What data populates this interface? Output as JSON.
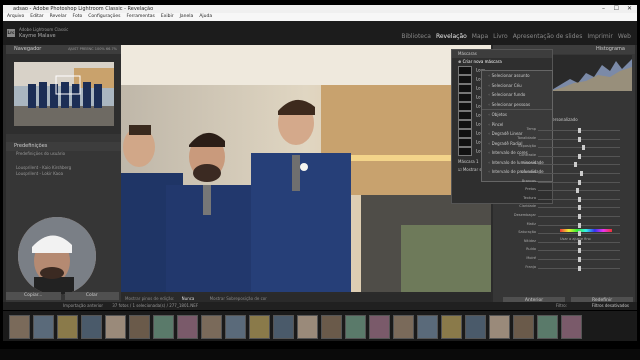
{
  "window": {
    "title": "adsao - Adobe Photoshop Lightroom Classic - Revelação",
    "controls": [
      "–",
      "☐",
      "✕"
    ]
  },
  "menubar": [
    "Arquivo",
    "Editar",
    "Revelar",
    "Foto",
    "Configurações",
    "Ferramentas",
    "Exibir",
    "Janela",
    "Ajuda"
  ],
  "identity": {
    "logo": "Lrc",
    "product": "Adobe Lightroom Classic",
    "user": "Kayme Malave"
  },
  "modules": [
    "Biblioteca",
    "Revelação",
    "Mapa",
    "Livro",
    "Apresentação de slides",
    "Imprimir",
    "Web"
  ],
  "active_module": "Revelação",
  "left_panel": {
    "navigator": {
      "title": "Navegador",
      "zoom_fit": "AJUST",
      "zoom_fill": "PREENC",
      "zoom_100": "100%",
      "zoom_custom": "66.7%"
    },
    "presets_title": "Predefinições",
    "preset_groups": [
      "Predefinições do usuário",
      "Lousprilent - Kaio Kirshberg",
      "Lousprilent - Lokir Kaoa"
    ],
    "copy_label": "Copiar...",
    "paste_label": "Colar"
  },
  "mask_panel": {
    "header": "Máscaras",
    "create_new": "Criar nova máscara",
    "items": [
      "Selecionar assunto",
      "Selecionar Céu",
      "Selecionar fundo",
      "Selecionar pessoas",
      "Objetos",
      "Pincel",
      "Degradê Linear",
      "Degradê Radial",
      "Intervalo de cores",
      "Intervalo de luminosidade",
      "Intervalo de profundidade"
    ],
    "mask_rows": [
      "Lous",
      "Lous",
      "Lous",
      "Lous",
      "Lous",
      "Lous",
      "Lous",
      "Lous",
      "Lous",
      "Lous"
    ],
    "footer_count": "Máscara 1",
    "overlay_label": "Mostrar sobreposição"
  },
  "right_panel": {
    "histogram": "Histograma",
    "mask_intensity_header": "Personalizado",
    "sliders": [
      {
        "label": "Temp",
        "value": 0.5
      },
      {
        "label": "Tonalidade",
        "value": 0.5
      },
      {
        "label": "Exposição",
        "value": 0.55
      },
      {
        "label": "Contraste",
        "value": 0.5
      },
      {
        "label": "Realces",
        "value": 0.45
      },
      {
        "label": "Sombras",
        "value": 0.52
      },
      {
        "label": "Brancos",
        "value": 0.5
      },
      {
        "label": "Pretos",
        "value": 0.48
      },
      {
        "label": "Textura",
        "value": 0.5
      },
      {
        "label": "Claridade",
        "value": 0.5
      },
      {
        "label": "Desembaçar",
        "value": 0.5
      },
      {
        "label": "Matiz",
        "value": 0.5
      },
      {
        "label": "Saturação",
        "value": 0.5
      },
      {
        "label": "Nitidez",
        "value": 0.5
      },
      {
        "label": "Ruído",
        "value": 0.5
      },
      {
        "label": "Moiré",
        "value": 0.5
      },
      {
        "label": "Franja",
        "value": 0.5
      }
    ],
    "hue_label": "Usar o ajuste fino",
    "prev_label": "Anterior",
    "reset_label": "Redefinir"
  },
  "photo_toolbar": {
    "mask_label": "Mostrar pinos de edição:",
    "mode": "Nunca",
    "overlay": "Mostrar Sobreposição de cor"
  },
  "filmstrip_bar": {
    "path": "Importação anterior",
    "count": "37 fotos / 1 selecionada(s) / 277_1801.NEF",
    "filter_label": "Filtro:",
    "filter_value": "Filtros desativados"
  },
  "filmstrip_count": 24
}
